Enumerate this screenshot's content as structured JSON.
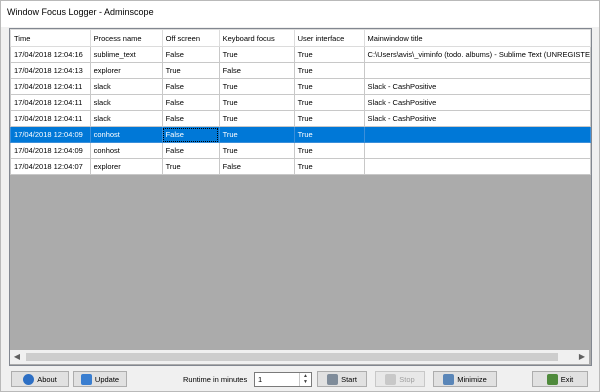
{
  "window": {
    "title": "Window Focus Logger - Adminscope"
  },
  "table": {
    "columns": [
      "Time",
      "Process name",
      "Off screen",
      "Keyboard focus",
      "User interface",
      "Mainwindow title"
    ],
    "rows": [
      [
        "17/04/2018 12:04:16",
        "sublime_text",
        "False",
        "True",
        "True",
        "C:\\Users\\avis\\_viminfo (todo. albums) - Sublime Text (UNREGISTE"
      ],
      [
        "17/04/2018 12:04:13",
        "explorer",
        "True",
        "False",
        "True",
        ""
      ],
      [
        "17/04/2018 12:04:11",
        "slack",
        "False",
        "True",
        "True",
        "Slack - CashPositive"
      ],
      [
        "17/04/2018 12:04:11",
        "slack",
        "False",
        "True",
        "True",
        "Slack - CashPositive"
      ],
      [
        "17/04/2018 12:04:11",
        "slack",
        "False",
        "True",
        "True",
        "Slack - CashPositive"
      ],
      [
        "17/04/2018 12:04:09",
        "conhost",
        "False",
        "True",
        "True",
        ""
      ],
      [
        "17/04/2018 12:04:09",
        "conhost",
        "False",
        "True",
        "True",
        ""
      ],
      [
        "17/04/2018 12:04:07",
        "explorer",
        "True",
        "False",
        "True",
        ""
      ]
    ],
    "selected_row": 5
  },
  "toolbar": {
    "about_label": "About",
    "update_label": "Update",
    "runtime_label": "Runtime in minutes",
    "runtime_value": "1",
    "start_label": "Start",
    "stop_label": "Stop",
    "minimize_label": "Minimize",
    "exit_label": "Exit"
  },
  "icons": {
    "about": "info-icon",
    "update": "refresh-icon",
    "start": "play-icon",
    "stop": "stop-icon",
    "minimize": "minimize-icon",
    "exit": "exit-icon"
  },
  "colors": {
    "selection": "#0078d7",
    "grid_background": "#ababab"
  }
}
